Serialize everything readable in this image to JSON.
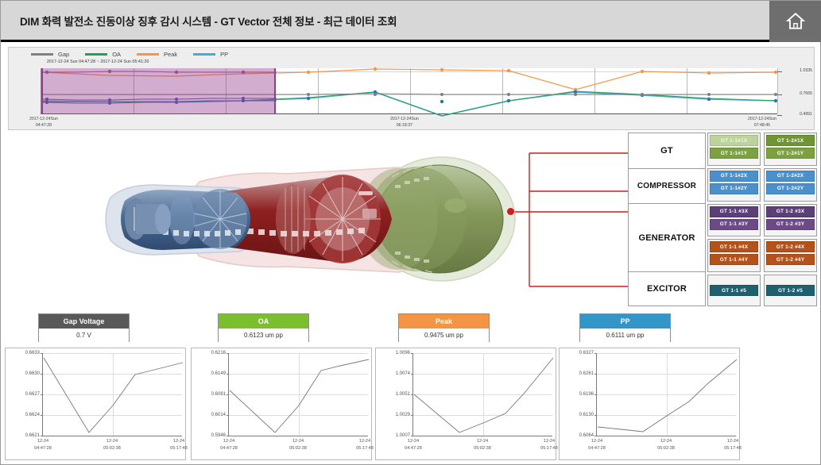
{
  "header": {
    "title": "DIM  화력 발전소 진동이상 징후 감시 시스템 - GT Vector 전체 정보 - 최근 데이터 조회",
    "home_icon": "home-icon"
  },
  "overview": {
    "legend": [
      {
        "label": "Gap",
        "color": "#808080"
      },
      {
        "label": "OA",
        "color": "#21a05a"
      },
      {
        "label": "Peak",
        "color": "#f59547"
      },
      {
        "label": "PP",
        "color": "#4aa8d8"
      }
    ],
    "selection_label": "2017-12-24 Sun 04:47:28 ~ 2017-12-24 Sun 05:41:20",
    "x_ticks": [
      {
        "date": "2017-12-24Sun",
        "time": "04:47:28"
      },
      {
        "date": "2017-12-24Sun",
        "time": "06:18:37"
      },
      {
        "date": "2017-12-24Sun",
        "time": "07:48:45"
      }
    ],
    "y_ticks": [
      "1.0335",
      "0.7665",
      "0.4991"
    ]
  },
  "components": [
    {
      "label": "GT"
    },
    {
      "label": "COMPRESSOR"
    },
    {
      "label": "GENERATOR"
    },
    {
      "label": "EXCITOR"
    }
  ],
  "sensor_groups": [
    {
      "color": "#7ba23f",
      "left": [
        {
          "label": "GT 1-1#1X",
          "color": "#bcd49a"
        },
        {
          "label": "GT 1-1#1Y",
          "color": "#7ba23f"
        }
      ],
      "right": [
        {
          "label": "GT 1-2#1X",
          "color": "#6f9433"
        },
        {
          "label": "GT 1-2#1Y",
          "color": "#7ba23f"
        }
      ]
    },
    {
      "color": "#4a90cd",
      "left": [
        {
          "label": "GT 1-1#2X",
          "color": "#4a90cd"
        },
        {
          "label": "GT 1-1#2Y",
          "color": "#4a90cd"
        }
      ],
      "right": [
        {
          "label": "GT 1-2#2X",
          "color": "#4a90cd"
        },
        {
          "label": "GT 1-2#2Y",
          "color": "#4a90cd"
        }
      ]
    },
    {
      "color": "#5c3f75",
      "left": [
        {
          "label": "GT 1-1 #3X",
          "color": "#5c3f75"
        },
        {
          "label": "GT 1-1 #3Y",
          "color": "#6b4a86"
        }
      ],
      "right": [
        {
          "label": "GT 1-2 #3X",
          "color": "#5c3f75"
        },
        {
          "label": "GT 1-2 #3Y",
          "color": "#6b4a86"
        }
      ]
    },
    {
      "color": "#b4521a",
      "left": [
        {
          "label": "GT 1-1 #4X",
          "color": "#b4521a"
        },
        {
          "label": "GT 1-1 #4Y",
          "color": "#b4521a"
        }
      ],
      "right": [
        {
          "label": "GT 1-2 #4X",
          "color": "#b4521a"
        },
        {
          "label": "GT 1-2 #4Y",
          "color": "#b4521a"
        }
      ]
    },
    {
      "color": "#1f5f6e",
      "left": [
        {
          "label": "GT 1-1 #5",
          "color": "#1f5f6e"
        }
      ],
      "right": [
        {
          "label": "GT 1-2 #5",
          "color": "#1f5f6e"
        }
      ]
    }
  ],
  "cards": [
    {
      "title": "Gap Voltage",
      "value": "0.7 V",
      "color": "#595959",
      "text_color": "#ffffff"
    },
    {
      "title": "OA",
      "value": "0.6123 um pp",
      "color": "#7cbf2e",
      "text_color": "#ffffff"
    },
    {
      "title": "Peak",
      "value": "0.9475 um pp",
      "color": "#f49545",
      "text_color": "#ffffff"
    },
    {
      "title": "PP",
      "value": "0.6111 um pp",
      "color": "#3396c8",
      "text_color": "#ffffff"
    }
  ],
  "chart_data": [
    {
      "type": "line",
      "title": "Gap Voltage",
      "ylabel": "V",
      "ylim": [
        0.6621,
        0.6633
      ],
      "y_ticks": [
        "0.6633",
        "0.6630",
        "0.6627",
        "0.6624",
        "0.6621"
      ],
      "x_ticks": [
        {
          "date": "12-24",
          "time": "04:47:28"
        },
        {
          "date": "12-24",
          "time": "05:02:38"
        },
        {
          "date": "12-24",
          "time": "05:17:48"
        }
      ],
      "values": [
        0.66325,
        0.66295,
        0.66255,
        0.66215,
        0.66268,
        0.66312,
        0.66316,
        0.66322
      ],
      "grid": true,
      "legend": "none"
    },
    {
      "type": "line",
      "title": "OA",
      "ylabel": "um pp",
      "ylim": [
        0.5946,
        0.6216
      ],
      "y_ticks": [
        "0.6216",
        "0.6149",
        "0.6081",
        "0.6014",
        "0.5946"
      ],
      "x_ticks": [
        {
          "date": "12-24",
          "time": "04:47:28"
        },
        {
          "date": "12-24",
          "time": "05:02:38"
        },
        {
          "date": "12-24",
          "time": "05:17:48"
        }
      ],
      "values": [
        0.6093,
        0.604,
        0.5985,
        0.5956,
        0.6051,
        0.6163,
        0.6185,
        0.6208
      ],
      "grid": true,
      "legend": "none"
    },
    {
      "type": "line",
      "title": "Peak",
      "ylabel": "um pp",
      "ylim": [
        1.0007,
        1.0096
      ],
      "y_ticks": [
        "1.0096",
        "1.0074",
        "1.0051",
        "1.0029",
        "1.0007"
      ],
      "x_ticks": [
        {
          "date": "12-24",
          "time": "04:47:28"
        },
        {
          "date": "12-24",
          "time": "05:02:38"
        },
        {
          "date": "12-24",
          "time": "05:17:48"
        }
      ],
      "values": [
        1.0051,
        1.0032,
        1.0011,
        1.0018,
        1.0025,
        1.0031,
        1.0062,
        1.0091
      ],
      "grid": true,
      "legend": "none"
    },
    {
      "type": "line",
      "title": "PP",
      "ylabel": "um pp",
      "ylim": [
        0.6064,
        0.6327
      ],
      "y_ticks": [
        "0.6327",
        "0.6261",
        "0.6196",
        "0.6130",
        "0.6064"
      ],
      "x_ticks": [
        {
          "date": "12-24",
          "time": "04:47:28"
        },
        {
          "date": "12-24",
          "time": "05:02:38"
        },
        {
          "date": "12-24",
          "time": "05:17:48"
        }
      ],
      "values": [
        0.6092,
        0.6083,
        0.6073,
        0.6076,
        0.612,
        0.6163,
        0.6245,
        0.6318
      ],
      "grid": true,
      "legend": "none"
    },
    {
      "type": "line",
      "title": "GT Vector overview",
      "ylim": [
        0.4991,
        1.0335
      ],
      "y_ticks": [
        "1.0335",
        "0.7665",
        "0.4991"
      ],
      "series": [
        {
          "name": "Gap",
          "color": "#808080",
          "values": [
            0.7,
            0.7,
            0.7,
            0.7,
            0.7,
            0.702,
            0.7,
            0.7,
            0.7,
            0.7,
            0.7,
            0.7
          ]
        },
        {
          "name": "OA",
          "color": "#21a05a",
          "values": [
            0.612,
            0.61,
            0.608,
            0.613,
            0.62,
            0.643,
            0.556,
            0.612,
            0.64,
            0.63,
            0.618,
            0.611
          ]
        },
        {
          "name": "Peak",
          "color": "#f59547",
          "values": [
            1.01,
            1.002,
            1.0,
            1.005,
            1.009,
            1.018,
            1.017,
            1.015,
            0.965,
            1.012,
            1.008,
            1.01
          ]
        },
        {
          "name": "PP",
          "color": "#4aa8d8",
          "values": [
            0.608,
            0.607,
            0.606,
            0.61,
            0.618,
            0.641,
            0.556,
            0.611,
            0.639,
            0.629,
            0.617,
            0.611
          ]
        }
      ],
      "grid": true,
      "legend": "top-left"
    }
  ]
}
